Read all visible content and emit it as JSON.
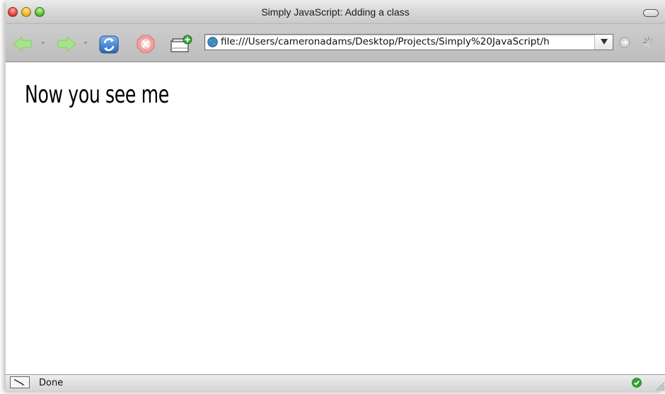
{
  "window": {
    "title": "Simply JavaScript: Adding a class"
  },
  "toolbar": {
    "back_icon": "back-arrow-icon",
    "forward_icon": "forward-arrow-icon",
    "reload_icon": "reload-icon",
    "stop_icon": "stop-icon",
    "new_tab_icon": "new-tab-icon",
    "url": "file:///Users/cameronadams/Desktop/Projects/Simply%20JavaScript/h",
    "go_icon": "go-arrow-icon",
    "throbber_icon": "loading-throbber-icon"
  },
  "page": {
    "heading": "Now you see me"
  },
  "status": {
    "text": "Done",
    "security_icon": "green-check-icon"
  },
  "colors": {
    "chrome_gray": "#c4c4c4",
    "nav_arrow_green": "#9ddc7f",
    "stop_red": "#ec8a86",
    "reload_blue": "#3e7fd0",
    "status_ok_green": "#2fa52f"
  }
}
